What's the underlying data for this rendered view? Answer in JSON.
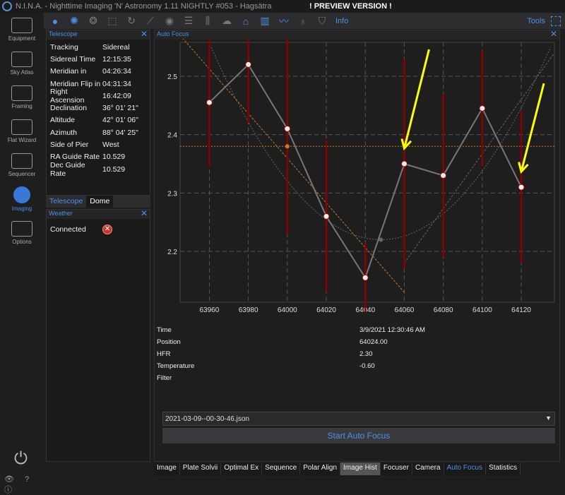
{
  "window": {
    "title": "N.I.N.A. - Nighttime Imaging 'N' Astronomy 1.11 NIGHTLY #053  -  Hagsätra",
    "preview": "! PREVIEW VERSION !"
  },
  "toolbar": {
    "icons": [
      "imaging-circle-icon",
      "aperture-icon",
      "filter-wheel-icon",
      "crop-icon",
      "rotator-icon",
      "telescope-icon",
      "guider-icon",
      "list-icon",
      "sliders-icon",
      "cloud-icon",
      "dome-icon",
      "chart-bar-icon",
      "graph-icon",
      "bulb-icon",
      "shield-icon"
    ],
    "info_label": "Info",
    "tools_label": "Tools"
  },
  "sidebar": {
    "items": [
      {
        "label": "Equipment"
      },
      {
        "label": "Sky Atlas"
      },
      {
        "label": "Framing"
      },
      {
        "label": "Flat Wizard"
      },
      {
        "label": "Sequencer"
      },
      {
        "label": "Imaging",
        "active": true
      },
      {
        "label": "Options"
      }
    ],
    "bottom": "👁 ? ⓘ"
  },
  "telescope": {
    "title": "Telescope",
    "rows": [
      {
        "k": "Tracking",
        "v": "Sidereal"
      },
      {
        "k": "Sidereal Time",
        "v": "12:15:35"
      },
      {
        "k": "Meridian in",
        "v": "04:26:34"
      },
      {
        "k": "Meridian Flip in",
        "v": "04:31:34"
      },
      {
        "k": "Right Ascension",
        "v": "16:42:09"
      },
      {
        "k": "Declination",
        "v": "36° 01' 21\""
      },
      {
        "k": "Altitude",
        "v": "42° 01' 06\""
      },
      {
        "k": "Azimuth",
        "v": "88° 04' 25\""
      },
      {
        "k": "Side of Pier",
        "v": "West"
      },
      {
        "k": "RA Guide Rate",
        "v": "10.529"
      },
      {
        "k": "Dec Guide Rate",
        "v": "10.529"
      }
    ],
    "tabs": [
      "Telescope",
      "Dome"
    ]
  },
  "weather": {
    "title": "Weather",
    "label": "Connected",
    "status": "disconnected"
  },
  "autofocus": {
    "title": "Auto Focus",
    "info": [
      {
        "k": "Time",
        "v": "3/9/2021 12:30:46 AM"
      },
      {
        "k": "Position",
        "v": "64024.00"
      },
      {
        "k": "HFR",
        "v": "2.30"
      },
      {
        "k": "Temperature",
        "v": "-0.60"
      },
      {
        "k": "Filter",
        "v": ""
      }
    ],
    "file": "2021-03-09--00-30-46.json",
    "start_label": "Start Auto Focus"
  },
  "chart_data": {
    "type": "scatter",
    "xlim": [
      63945,
      64137
    ],
    "ylim": [
      2.113,
      2.558
    ],
    "xticks": [
      63960,
      63980,
      64000,
      64020,
      64040,
      64060,
      64080,
      64100,
      64120
    ],
    "yticks": [
      2.2,
      2.3,
      2.4,
      2.5
    ],
    "grid": true,
    "points": [
      {
        "x": 63960,
        "y": 2.455,
        "err": 0.11
      },
      {
        "x": 63980,
        "y": 2.52,
        "err": 0.1
      },
      {
        "x": 64000,
        "y": 2.41,
        "err": 0.18
      },
      {
        "x": 64020,
        "y": 2.26,
        "err": 0.13
      },
      {
        "x": 64040,
        "y": 2.155,
        "err": 0.06
      },
      {
        "x": 64060,
        "y": 2.35,
        "err": 0.18
      },
      {
        "x": 64080,
        "y": 2.33,
        "err": 0.14
      },
      {
        "x": 64100,
        "y": 2.445,
        "err": 0.1
      },
      {
        "x": 64120,
        "y": 2.31,
        "err": 0.13
      }
    ],
    "left_trend": [
      [
        63945,
        2.57
      ],
      [
        64060,
        2.13
      ]
    ],
    "right_trend": [
      [
        64060,
        2.18
      ],
      [
        64137,
        2.54
      ]
    ],
    "parabola_min": {
      "x": 64048,
      "y": 2.22
    },
    "hfr_line": 2.38,
    "colors": {
      "points": "#f0f0f0",
      "error": "#8b0000",
      "line": "#777777",
      "trend": "#c87a1e",
      "parabola": "#666666",
      "arrow": "#ffff00"
    },
    "annotations": [
      {
        "type": "arrow",
        "target_x": 64060,
        "target_y": 2.35
      },
      {
        "type": "arrow",
        "target_x": 64120,
        "target_y": 2.31
      }
    ]
  },
  "tabs": [
    {
      "label": "Image"
    },
    {
      "label": "Plate Solvii"
    },
    {
      "label": "Optimal Ex"
    },
    {
      "label": "Sequence"
    },
    {
      "label": "Polar Align"
    },
    {
      "label": "Image Hist",
      "selected": true
    },
    {
      "label": "Focuser"
    },
    {
      "label": "Camera"
    },
    {
      "label": "Auto Focus",
      "active": true
    },
    {
      "label": "Statistics"
    }
  ]
}
